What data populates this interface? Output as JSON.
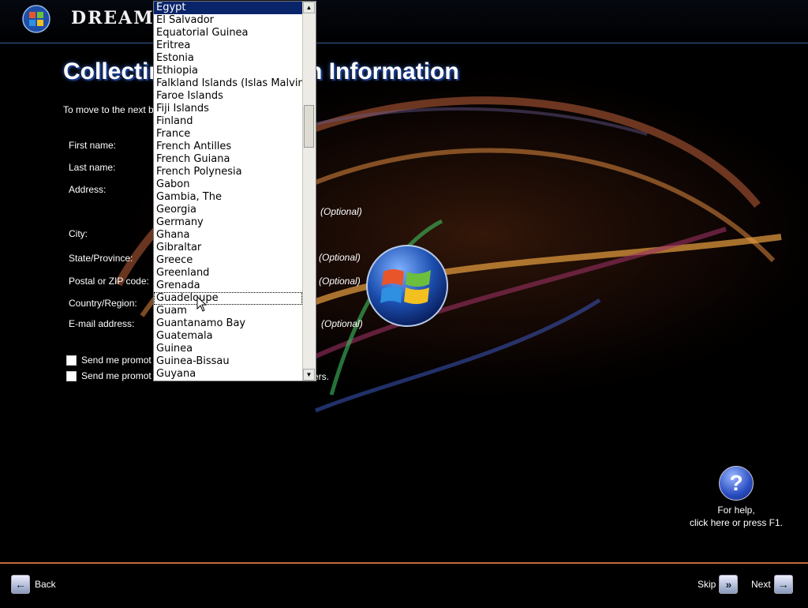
{
  "brand": "DREAM",
  "page_title": "Collecting Registration Information",
  "instructions": "To move to the next b",
  "fields": {
    "first_name": "First name:",
    "last_name": "Last name:",
    "address": "Address:",
    "city": "City:",
    "state": "State/Province:",
    "postal": "Postal or ZIP code:",
    "country": "Country/Region:",
    "email": "E-mail address:"
  },
  "optional_label": "(Optional)",
  "checkboxes": [
    {
      "label": "Send me promot",
      "checked": false
    },
    {
      "label": "Send me promot",
      "suffix": "ers.",
      "checked": false
    }
  ],
  "country_list": {
    "selected_value": "Egypt",
    "focused_value": "Guadeloupe",
    "items": [
      "Egypt",
      "El Salvador",
      "Equatorial Guinea",
      "Eritrea",
      "Estonia",
      "Ethiopia",
      "Falkland Islands (Islas Malvinas)",
      "Faroe Islands",
      "Fiji Islands",
      "Finland",
      "France",
      "French Antilles",
      "French Guiana",
      "French Polynesia",
      "Gabon",
      "Gambia, The",
      "Georgia",
      "Germany",
      "Ghana",
      "Gibraltar",
      "Greece",
      "Greenland",
      "Grenada",
      "Guadeloupe",
      "Guam",
      "Guantanamo Bay",
      "Guatemala",
      "Guinea",
      "Guinea-Bissau",
      "Guyana"
    ],
    "scroll_position": 0.3
  },
  "help": {
    "line1": "For help,",
    "line2": "click here or press F1."
  },
  "nav": {
    "back": "Back",
    "skip": "Skip",
    "next": "Next"
  },
  "colors": {
    "accent_blue": "#3b5f9a",
    "bottom_rule": "#c46a3a",
    "selection": "#0a246a"
  }
}
